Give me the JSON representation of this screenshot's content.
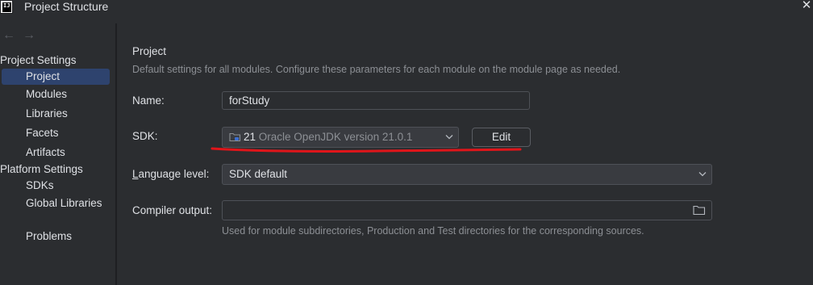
{
  "window": {
    "title": "Project Structure",
    "logo_text": "IJ",
    "close_glyph": "✕"
  },
  "sidebar": {
    "back_glyph": "←",
    "forward_glyph": "→",
    "groups": [
      {
        "header": "Project Settings",
        "items": [
          "Project",
          "Modules",
          "Libraries",
          "Facets",
          "Artifacts"
        ]
      },
      {
        "header": "Platform Settings",
        "items": [
          "SDKs",
          "Global Libraries"
        ]
      }
    ],
    "problems": "Problems",
    "selected": "Project"
  },
  "main": {
    "title": "Project",
    "description": "Default settings for all modules. Configure these parameters for each module on the module page as needed.",
    "name": {
      "label": "Name:",
      "value": "forStudy"
    },
    "sdk": {
      "label": "SDK:",
      "version": "21",
      "name": "Oracle OpenJDK version 21.0.1",
      "edit_label": "Edit"
    },
    "language_level": {
      "label_mnemonic": "L",
      "label_rest": "anguage level:",
      "value": "SDK default"
    },
    "compiler_output": {
      "label": "Compiler output:",
      "value": "",
      "hint": "Used for module subdirectories, Production and Test directories for the corresponding sources."
    }
  },
  "colors": {
    "background": "#2b2d30",
    "selection": "#2e436e",
    "annotation_stroke": "#e0151a"
  },
  "icons": [
    "folder-icon",
    "chevron-down-icon",
    "close-icon",
    "arrow-left-icon",
    "arrow-right-icon"
  ]
}
